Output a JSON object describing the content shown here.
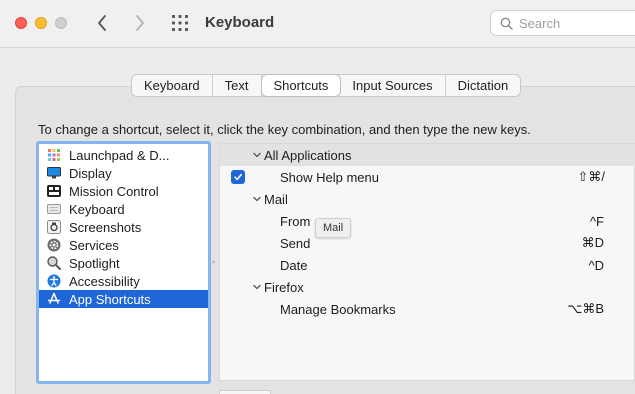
{
  "window": {
    "title": "Keyboard",
    "search_placeholder": "Search"
  },
  "tabs": [
    {
      "label": "Keyboard",
      "active": false
    },
    {
      "label": "Text",
      "active": false
    },
    {
      "label": "Shortcuts",
      "active": true
    },
    {
      "label": "Input Sources",
      "active": false
    },
    {
      "label": "Dictation",
      "active": false
    }
  ],
  "instruction": "To change a shortcut, select it, click the key combination, and then type the new keys.",
  "categories": [
    {
      "label": "Launchpad & D...",
      "icon": "launchpad-icon"
    },
    {
      "label": "Display",
      "icon": "display-icon"
    },
    {
      "label": "Mission Control",
      "icon": "mission-control-icon"
    },
    {
      "label": "Keyboard",
      "icon": "keyboard-icon"
    },
    {
      "label": "Screenshots",
      "icon": "screenshots-icon"
    },
    {
      "label": "Services",
      "icon": "services-gear-icon"
    },
    {
      "label": "Spotlight",
      "icon": "spotlight-magnifier-icon"
    },
    {
      "label": "Accessibility",
      "icon": "accessibility-icon"
    },
    {
      "label": "App Shortcuts",
      "icon": "app-store-icon",
      "selected": true
    }
  ],
  "shortcuts": {
    "groups": [
      {
        "name": "All Applications",
        "items": [
          {
            "label": "Show Help menu",
            "keys": "⇧⌘/",
            "checked": true
          }
        ]
      },
      {
        "name": "Mail",
        "items": [
          {
            "label": "From",
            "keys": "^F"
          },
          {
            "label": "Send",
            "keys": "⌘D"
          },
          {
            "label": "Date",
            "keys": "^D"
          }
        ]
      },
      {
        "name": "Firefox",
        "items": [
          {
            "label": "Manage Bookmarks",
            "keys": "⌥⌘B"
          }
        ]
      }
    ]
  },
  "tooltip": "Mail",
  "colors": {
    "accent": "#1f66d8",
    "focus_ring": "#87b5f0",
    "close": "#fe5f57",
    "minimize": "#febc2e"
  }
}
